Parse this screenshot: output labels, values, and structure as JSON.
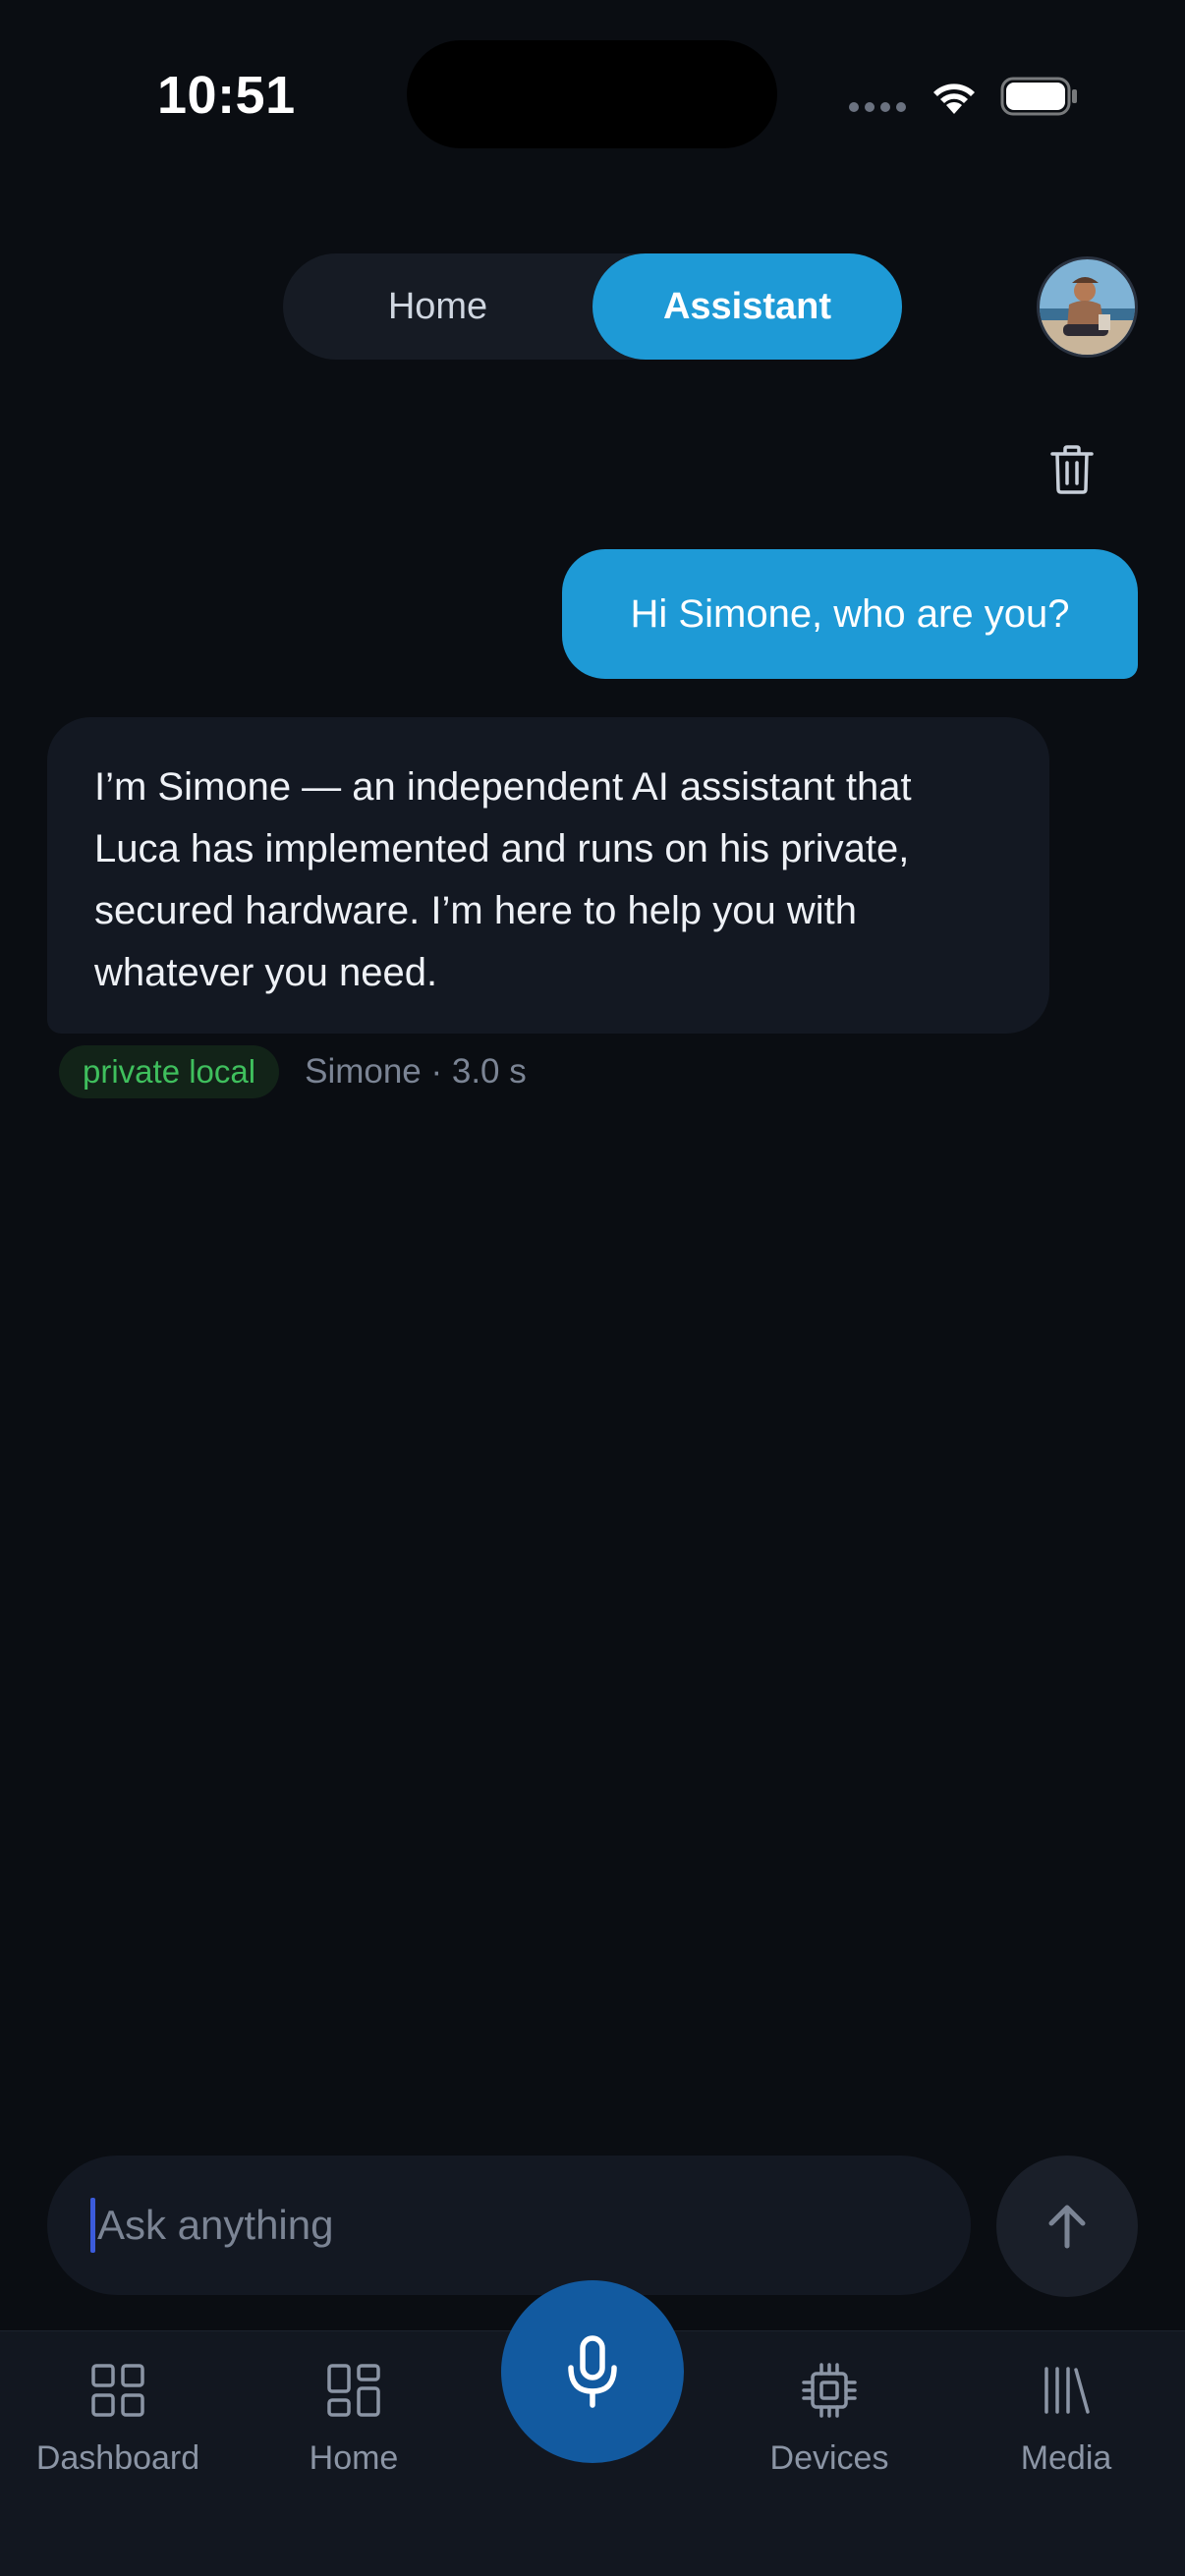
{
  "status_bar": {
    "time": "10:51"
  },
  "header": {
    "tabs": [
      {
        "label": "Home",
        "active": false
      },
      {
        "label": "Assistant",
        "active": true
      }
    ],
    "avatar_icon": "user-avatar"
  },
  "chat": {
    "clear_icon": "trash-icon",
    "messages": [
      {
        "role": "user",
        "text": "Hi Simone, who are you?"
      },
      {
        "role": "assistant",
        "text": "I’m Simone — an independent AI assistant that Luca has implemented and runs on his private, secured hardware. I’m here to help you with whatever you need."
      }
    ],
    "meta": {
      "badge": "private local",
      "info": "Simone · 3.0 s"
    }
  },
  "composer": {
    "placeholder": "Ask anything",
    "value": "",
    "send_icon": "arrow-up-icon"
  },
  "tab_bar": {
    "items": [
      {
        "label": "Dashboard",
        "icon": "grid-icon"
      },
      {
        "label": "Home",
        "icon": "layout-icon"
      },
      {
        "label": "Devices",
        "icon": "chip-icon"
      },
      {
        "label": "Media",
        "icon": "library-icon"
      }
    ],
    "mic_icon": "microphone-icon"
  },
  "colors": {
    "background": "#0a0d12",
    "accent": "#1e9ad6",
    "mic": "#125aa0",
    "badge_text": "#3fbf5d"
  }
}
